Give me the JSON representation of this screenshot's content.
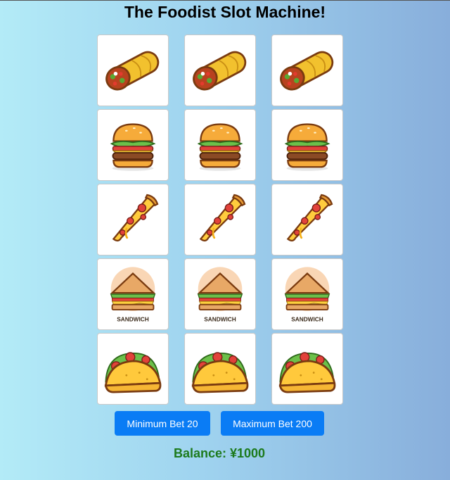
{
  "title": "The Foodist Slot Machine!",
  "reels": [
    [
      "burrito",
      "burrito",
      "burrito"
    ],
    [
      "burger",
      "burger",
      "burger"
    ],
    [
      "pizza",
      "pizza",
      "pizza"
    ],
    [
      "sandwich",
      "sandwich",
      "sandwich"
    ],
    [
      "taco",
      "taco",
      "taco"
    ]
  ],
  "sandwich_label": "SANDWICH",
  "buttons": {
    "min_bet": "Minimum Bet 20",
    "max_bet": "Maximum Bet 200"
  },
  "balance": "Balance: ¥1000",
  "colors": {
    "button": "#0a7cf5",
    "balance_text": "#1c7a1c"
  }
}
